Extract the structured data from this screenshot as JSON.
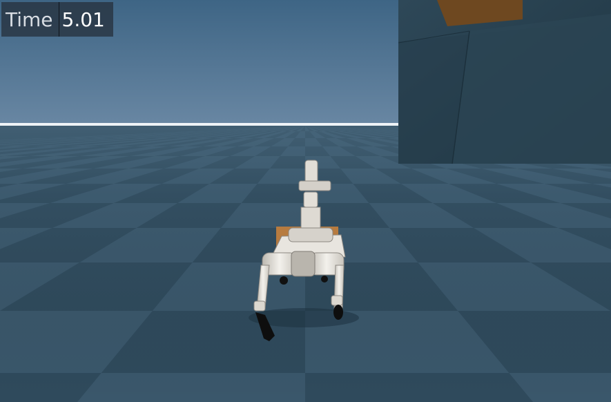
{
  "hud": {
    "time_label": "Time",
    "time_value": "5.01"
  },
  "scene": {
    "sky_color_top": "#3f6687",
    "sky_color_horizon": "#6c8aa6",
    "floor_light": "#3c5a6e",
    "floor_dark": "#2c4556",
    "horizon_line_color": "#e8eef3",
    "wall_color": "#2a4352",
    "box_color": "#7a4e24",
    "robot_body_color": "#e7e4de",
    "robot_foot_color": "#111111"
  }
}
